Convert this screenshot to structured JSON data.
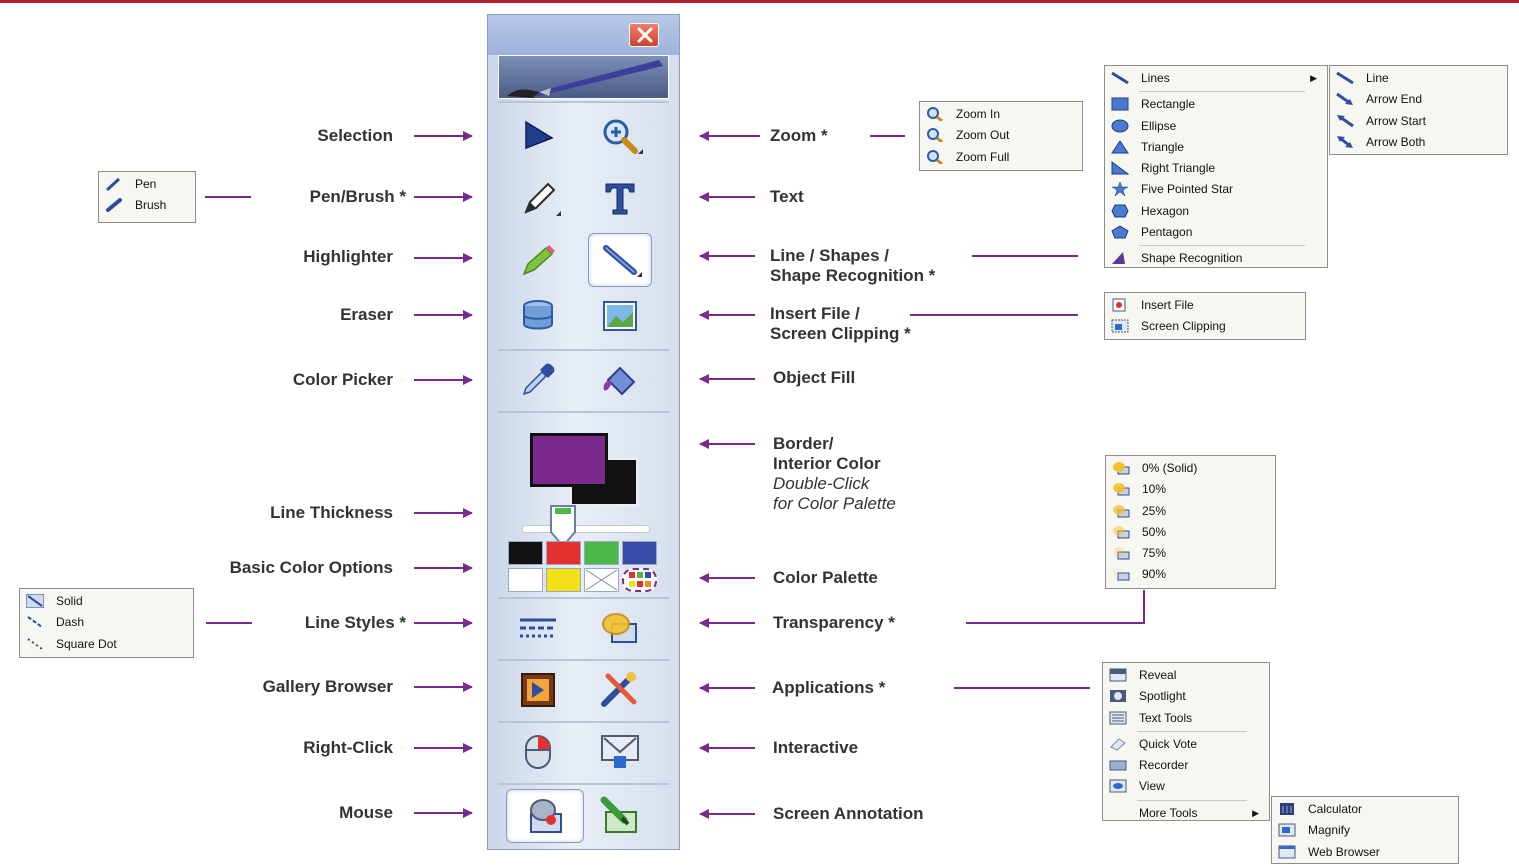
{
  "toolbar": {
    "labels_left": [
      "Selection",
      "Pen/Brush *",
      "Highlighter",
      "Eraser",
      "Color Picker",
      "Line Thickness",
      "Basic Color Options",
      "Line Styles *",
      "Gallery Browser",
      "Right-Click",
      "Mouse"
    ],
    "labels_right": {
      "zoom": "Zoom *",
      "text": "Text",
      "shapes_1": "Line / Shapes /",
      "shapes_2": "Shape Recognition *",
      "insert_1": "Insert File /",
      "insert_2": "Screen Clipping *",
      "fill": "Object Fill",
      "border_1": "Border/",
      "border_2": "Interior Color",
      "border_3": "Double-Click",
      "border_4": "for Color Palette",
      "palette": "Color Palette",
      "transparency": "Transparency *",
      "applications": "Applications *",
      "interactive": "Interactive",
      "annotation": "Screen Annotation"
    },
    "colors": {
      "border": "#7a2a8c",
      "interior": "#111111",
      "basic": [
        "#111111",
        "#e53030",
        "#4cb848",
        "#3a4aa8",
        "#ffffff",
        "#f2e018"
      ]
    }
  },
  "menus": {
    "pen": [
      "Pen",
      "Brush"
    ],
    "zoom": [
      "Zoom In",
      "Zoom Out",
      "Zoom Full"
    ],
    "shapes": [
      "Lines",
      "Rectangle",
      "Ellipse",
      "Triangle",
      "Right Triangle",
      "Five Pointed Star",
      "Hexagon",
      "Pentagon",
      "Shape Recognition"
    ],
    "lines_sub": [
      "Line",
      "Arrow End",
      "Arrow Start",
      "Arrow Both"
    ],
    "insert": [
      "Insert File",
      "Screen Clipping"
    ],
    "transparency": [
      "0% (Solid)",
      "10%",
      "25%",
      "50%",
      "75%",
      "90%"
    ],
    "line_styles": [
      "Solid",
      "Dash",
      "Square Dot"
    ],
    "applications": [
      "Reveal",
      "Spotlight",
      "Text Tools",
      "Quick Vote",
      "Recorder",
      "View",
      "More Tools"
    ],
    "more_tools": [
      "Calculator",
      "Magnify",
      "Web Browser"
    ]
  }
}
